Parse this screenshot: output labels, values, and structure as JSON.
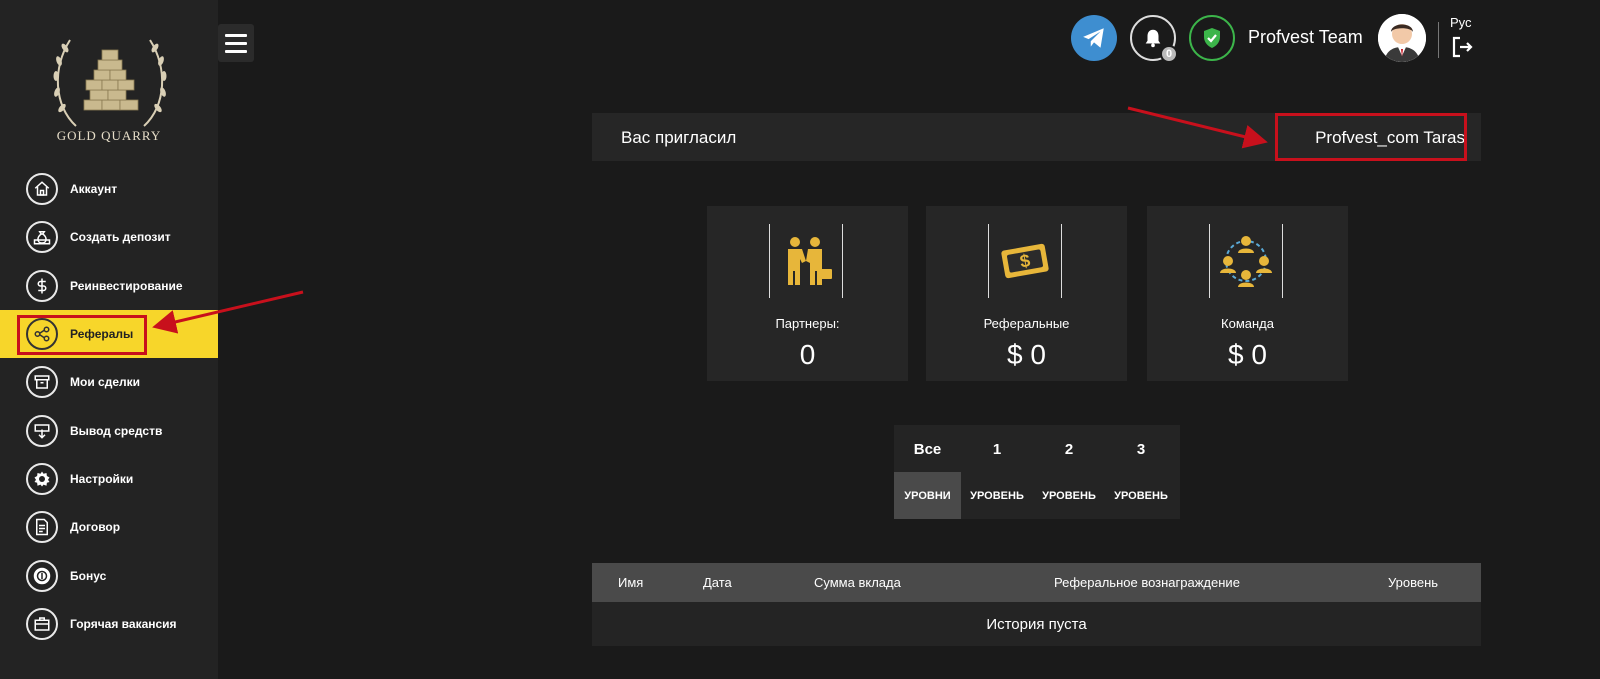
{
  "brand": {
    "logo_text": "GOLD QUARRY"
  },
  "sidebar": {
    "items": [
      {
        "label": "Аккаунт",
        "icon": "home-icon"
      },
      {
        "label": "Создать депозит",
        "icon": "money-bag-icon"
      },
      {
        "label": "Реинвестирование",
        "icon": "dollar-icon"
      },
      {
        "label": "Рефералы",
        "icon": "share-icon",
        "active": true
      },
      {
        "label": "Мои сделки",
        "icon": "box-icon"
      },
      {
        "label": "Вывод средств",
        "icon": "withdraw-icon"
      },
      {
        "label": "Настройки",
        "icon": "gear-icon"
      },
      {
        "label": "Договор",
        "icon": "document-icon"
      },
      {
        "label": "Бонус",
        "icon": "coin-icon"
      },
      {
        "label": "Горячая вакансия",
        "icon": "briefcase-icon"
      }
    ]
  },
  "header": {
    "notifications_count": "0",
    "username": "Profvest Team",
    "language": "Рус"
  },
  "invited": {
    "label": "Вас пригласил",
    "name": "Profvest_com Taras"
  },
  "stats": [
    {
      "title": "Партнеры:",
      "value": "0",
      "icon": "handshake-icon"
    },
    {
      "title": "Реферальные",
      "value": "$ 0",
      "icon": "dollar-bill-icon"
    },
    {
      "title": "Команда",
      "value": "$ 0",
      "icon": "team-icon"
    }
  ],
  "levels": [
    {
      "num": "Все",
      "caption": "УРОВНИ",
      "active": true
    },
    {
      "num": "1",
      "caption": "УРОВЕНЬ"
    },
    {
      "num": "2",
      "caption": "УРОВЕНЬ"
    },
    {
      "num": "3",
      "caption": "УРОВЕНЬ"
    }
  ],
  "table": {
    "columns": [
      "Имя",
      "Дата",
      "Сумма вклада",
      "Реферальное вознаграждение",
      "Уровень"
    ],
    "empty_text": "История пуста"
  },
  "colors": {
    "accent": "#f7d62a",
    "highlight": "#c8101c",
    "telegram": "#3e8ed0",
    "verified": "#3cb54a",
    "gold": "#e7b63a"
  }
}
